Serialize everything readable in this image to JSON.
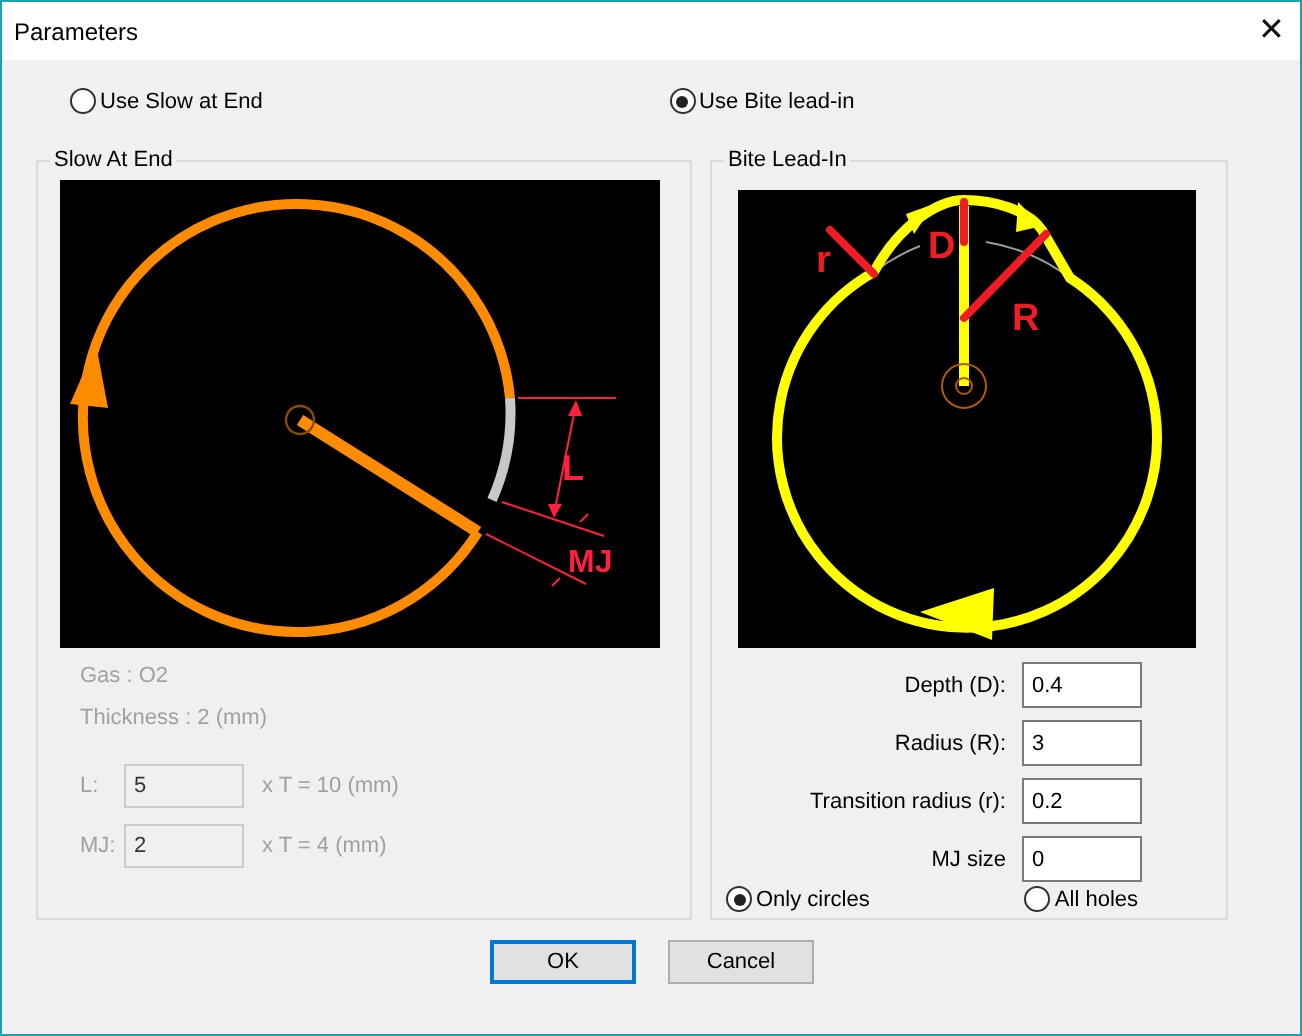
{
  "window": {
    "title": "Parameters",
    "close": "✕"
  },
  "modes": [
    {
      "label": "Use Slow at End",
      "selected": false
    },
    {
      "label": "Use Bite lead-in",
      "selected": true
    }
  ],
  "slow_at_end": {
    "title": "Slow At End",
    "disabled": true,
    "diagram_labels": [
      "L",
      "MJ"
    ],
    "info": [
      "Gas : O2",
      "Thickness : 2 (mm)"
    ],
    "fields": [
      {
        "label": "L:",
        "value": "5",
        "result": "x T = 10 (mm)"
      },
      {
        "label": "MJ:",
        "value": "2",
        "result": "x T = 4 (mm)"
      }
    ]
  },
  "bite_lead_in": {
    "title": "Bite Lead-In",
    "diagram_labels": [
      "r",
      "D",
      "R"
    ],
    "fields": [
      {
        "label": "Depth (D):",
        "value": "0.4"
      },
      {
        "label": "Radius (R):",
        "value": "3"
      },
      {
        "label": "Transition radius (r):",
        "value": "0.2"
      },
      {
        "label": "MJ size",
        "value": "0"
      }
    ],
    "scope": [
      {
        "label": "Only circles",
        "selected": true
      },
      {
        "label": "All holes",
        "selected": false
      }
    ]
  },
  "buttons": [
    {
      "label": "OK",
      "default": true
    },
    {
      "label": "Cancel",
      "default": false
    }
  ]
}
